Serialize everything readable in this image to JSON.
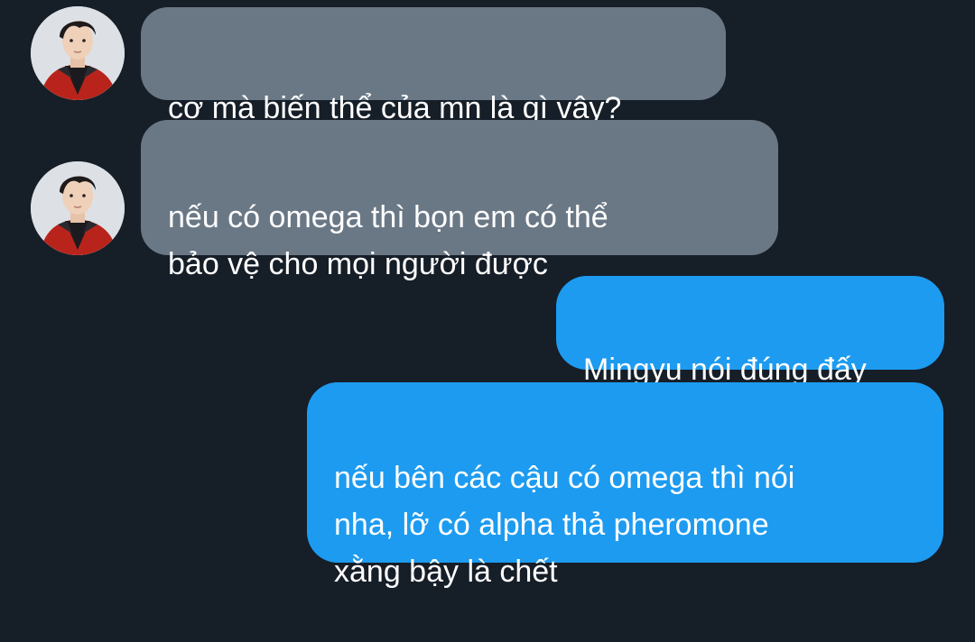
{
  "messages": [
    {
      "direction": "incoming",
      "text": "cơ mà biến thể của mn là gì vậy?"
    },
    {
      "direction": "incoming",
      "text": "nếu có omega thì bọn em có thể\nbảo vệ cho mọi người được"
    },
    {
      "direction": "outgoing",
      "text": "Mingyu nói đúng đấy"
    },
    {
      "direction": "outgoing",
      "text": "nếu bên các cậu có omega thì nói\nnha, lỡ có alpha thả pheromone\nxằng bậy là chết"
    }
  ],
  "colors": {
    "background": "#161e28",
    "incoming_bubble": "#6a7886",
    "outgoing_bubble": "#1d9bf0",
    "text": "#ffffff"
  },
  "icons": {
    "avatar": "contact-avatar-photo"
  }
}
